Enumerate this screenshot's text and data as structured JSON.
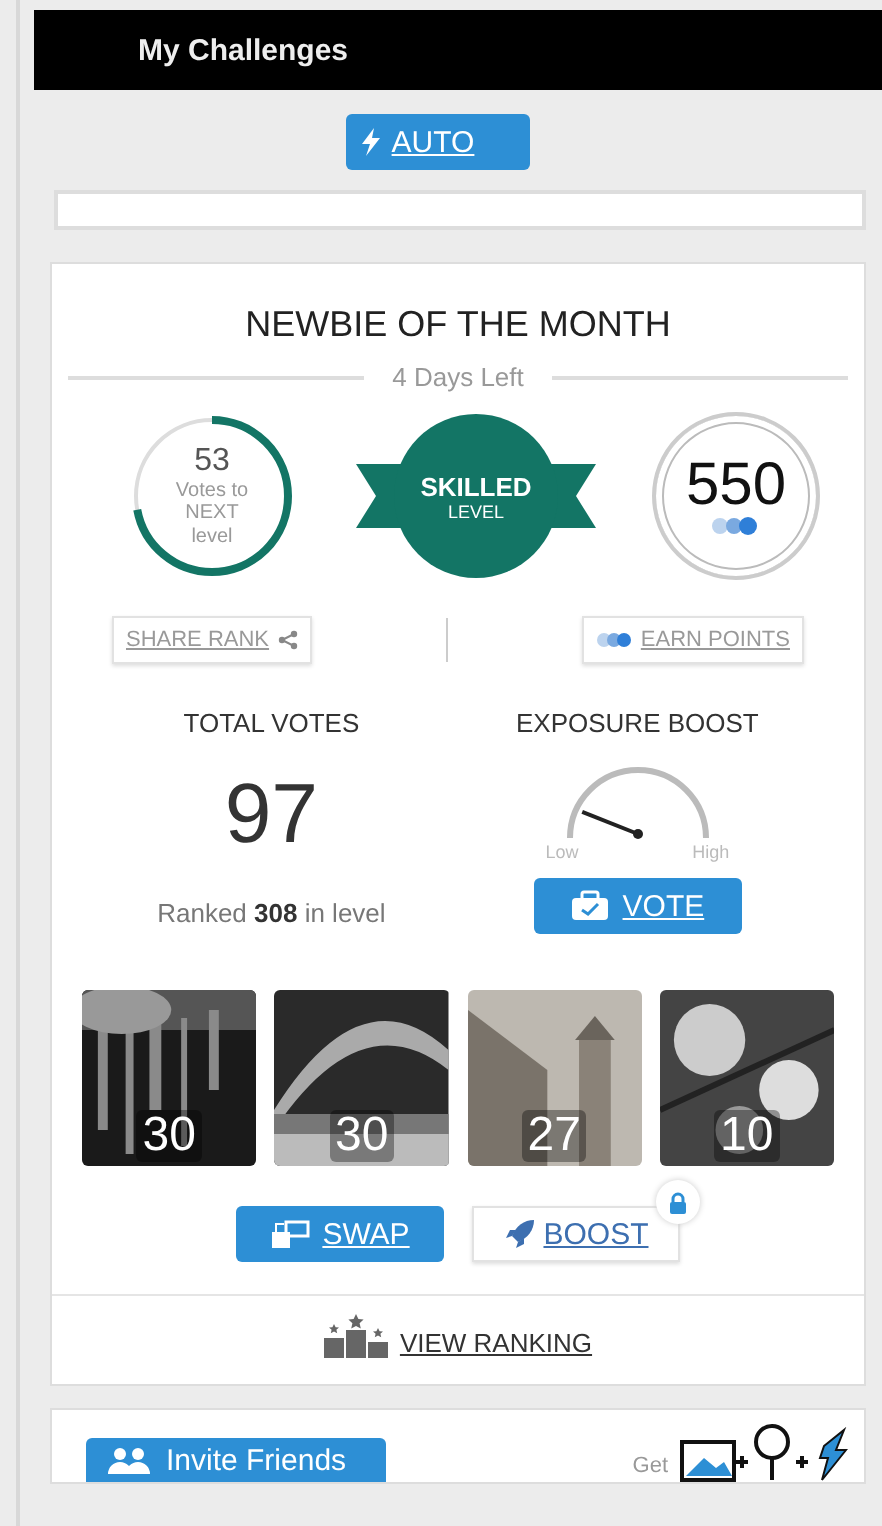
{
  "header": {
    "title": "My Challenges"
  },
  "auto_button": {
    "label": "AUTO"
  },
  "challenge": {
    "title": "NEWBIE OF THE MONTH",
    "days_left": "4 Days Left",
    "progress": {
      "count": "53",
      "caption": "Votes to NEXT level",
      "level": 0.72
    },
    "level_badge": {
      "name": "SKILLED",
      "caption": "LEVEL"
    },
    "points": "550",
    "share_button": "SHARE RANK",
    "earn_button": "EARN POINTS",
    "total_votes": {
      "label": "TOTAL VOTES",
      "value": "97",
      "rank_text": "Ranked **308** in level"
    },
    "exposure": {
      "label": "EXPOSURE BOOST",
      "level": 0.12,
      "low": "Low",
      "high": "High",
      "vote_button": "VOTE"
    },
    "photos": [
      {
        "kind": "picture",
        "votes": "30"
      },
      {
        "kind": "picture",
        "votes": "30"
      },
      {
        "kind": "picture",
        "votes": "27"
      },
      {
        "kind": "picture",
        "votes": "10"
      }
    ],
    "swap_button": "SWAP",
    "boost_button": {
      "label": "BOOST",
      "locked": true
    },
    "view_ranking": "VIEW RANKING"
  },
  "invite": {
    "button": "Invite Friends",
    "get": "Get"
  }
}
